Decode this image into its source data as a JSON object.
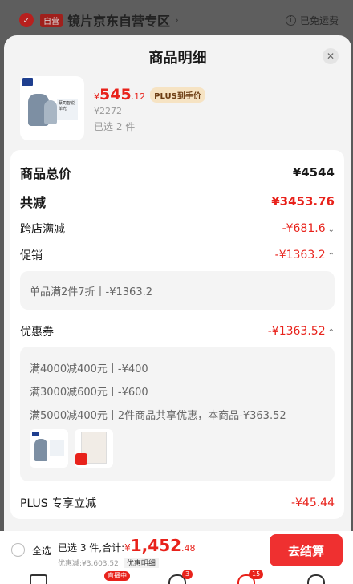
{
  "background": {
    "store_badge": "自营",
    "store_name": "镜片京东自营专区",
    "shipping": "已免运费"
  },
  "sheet": {
    "title": "商品明细",
    "product": {
      "thumb_text": "蔡司智锐\n单光",
      "currency": "¥",
      "price_int": "545",
      "price_dec": ".12",
      "plus_tag": "PLUS到手价",
      "original_price": "¥2272",
      "selected": "已选 2 件"
    },
    "details": {
      "total_label": "商品总价",
      "total_value": "¥4544",
      "reduce_label": "共减",
      "reduce_value": "¥3453.76",
      "cross_store_label": "跨店满减",
      "cross_store_value": "-¥681.6",
      "promo_label": "促销",
      "promo_value": "-¥1363.2",
      "promo_detail": "单品满2件7折丨-¥1363.2",
      "coupon_label": "优惠券",
      "coupon_value": "-¥1363.52",
      "coupon_lines": [
        "满4000减400元丨-¥400",
        "满3000减600元丨-¥600",
        "满5000减400元丨2件商品共享优惠，本商品-¥363.52"
      ],
      "plus_label": "PLUS 专享立减",
      "plus_value": "-¥45.44"
    }
  },
  "checkout": {
    "select_all": "全选",
    "summary": "已选 3 件,合计:",
    "currency": "¥",
    "total_int": "1,452",
    "total_dec": ".48",
    "discount_text": "优惠减:¥3,603.52",
    "discount_detail": "优惠明细",
    "button": "去结算"
  },
  "nav": {
    "live_badge": "直播中",
    "msg_count": "3",
    "cart_count": "15"
  },
  "colors": {
    "accent": "#e8221b",
    "checkout_button": "#ef3030"
  }
}
